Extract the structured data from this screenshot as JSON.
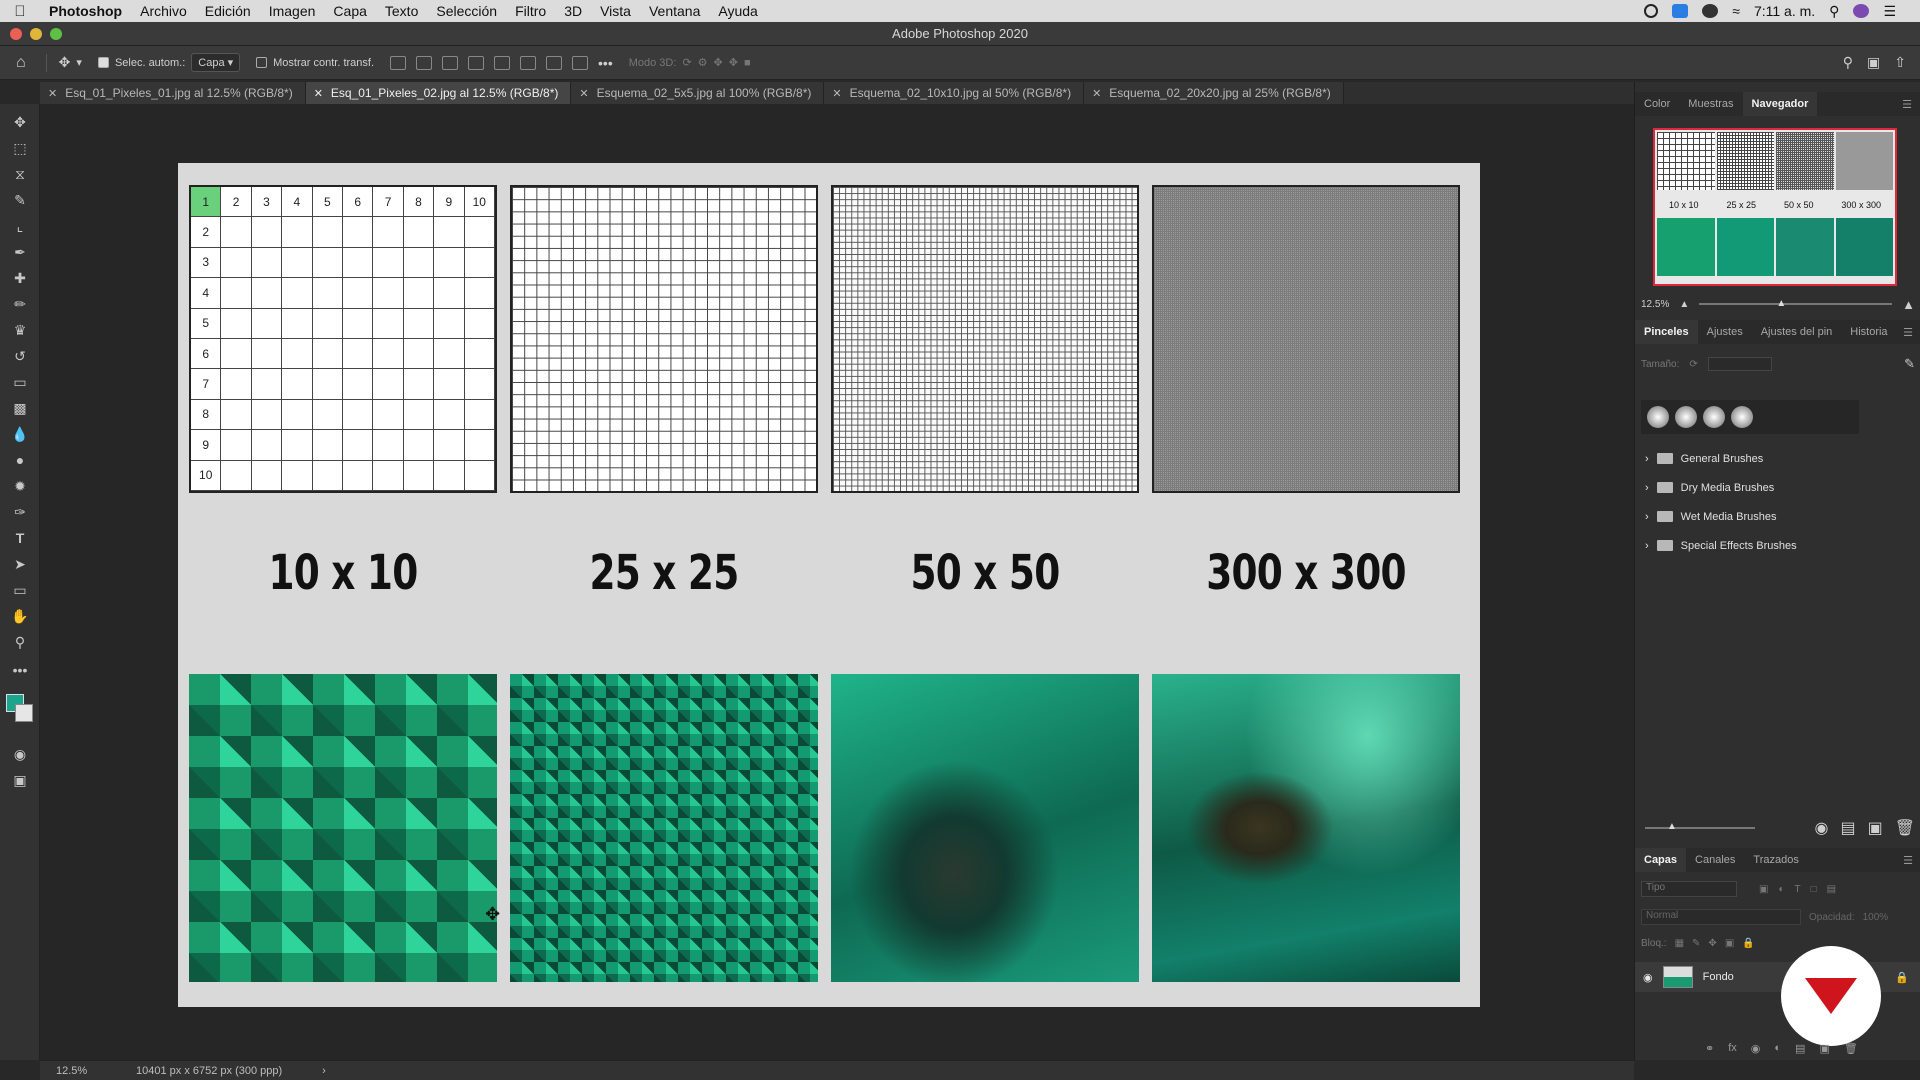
{
  "menubar": {
    "app": "Photoshop",
    "items": [
      "Archivo",
      "Edición",
      "Imagen",
      "Capa",
      "Texto",
      "Selección",
      "Filtro",
      "3D",
      "Vista",
      "Ventana",
      "Ayuda"
    ],
    "time": "7:11 a. m."
  },
  "window": {
    "title": "Adobe Photoshop 2020"
  },
  "options": {
    "auto_select_label": "Selec. autom.:",
    "auto_select_value": "Capa",
    "show_transform_label": "Mostrar contr. transf.",
    "mode3d_label": "Modo 3D:"
  },
  "tabs": [
    {
      "label": "Esq_01_Pixeles_01.jpg al 12.5% (RGB/8*)"
    },
    {
      "label": "Esq_01_Pixeles_02.jpg al 12.5% (RGB/8*)"
    },
    {
      "label": "Esquema_02_5x5.jpg al 100% (RGB/8*)"
    },
    {
      "label": "Esquema_02_10x10.jpg al 50% (RGB/8*)"
    },
    {
      "label": "Esquema_02_20x20.jpg al 25% (RGB/8*)"
    }
  ],
  "active_tab_index": 1,
  "document": {
    "grid_numbers_top": [
      "1",
      "2",
      "3",
      "4",
      "5",
      "6",
      "7",
      "8",
      "9",
      "10"
    ],
    "grid_numbers_left": [
      "2",
      "3",
      "4",
      "5",
      "6",
      "7",
      "8",
      "9",
      "10"
    ],
    "labels": [
      "10 x 10",
      "25 x 25",
      "50 x 50",
      "300 x 300"
    ]
  },
  "navigator_panel": {
    "tabs": [
      "Color",
      "Muestras",
      "Navegador"
    ],
    "active": "Navegador",
    "zoom": "12.5%",
    "thumb_labels": [
      "10 x 10",
      "25 x 25",
      "50 x 50",
      "300 x 300"
    ]
  },
  "brushes_panel": {
    "tabs": [
      "Pinceles",
      "Ajustes",
      "Ajustes del pin",
      "Historia"
    ],
    "active": "Pinceles",
    "size_label": "Tamaño:",
    "groups": [
      "General Brushes",
      "Dry Media Brushes",
      "Wet Media Brushes",
      "Special Effects Brushes"
    ]
  },
  "layers_panel": {
    "tabs": [
      "Capas",
      "Canales",
      "Trazados"
    ],
    "active": "Capas",
    "search_placeholder": "Tipo",
    "blend_mode": "Normal",
    "opacity_label": "Opacidad:",
    "opacity_value": "100%",
    "lock_label": "Bloq.:",
    "layer_name": "Fondo"
  },
  "status": {
    "zoom": "12.5%",
    "doc_info": "10401 px x 6752 px (300 ppp)"
  },
  "colors": {
    "foreground": "#1aa58c",
    "background": "#e6e6e6",
    "navigator_frame": "#e0283c"
  }
}
